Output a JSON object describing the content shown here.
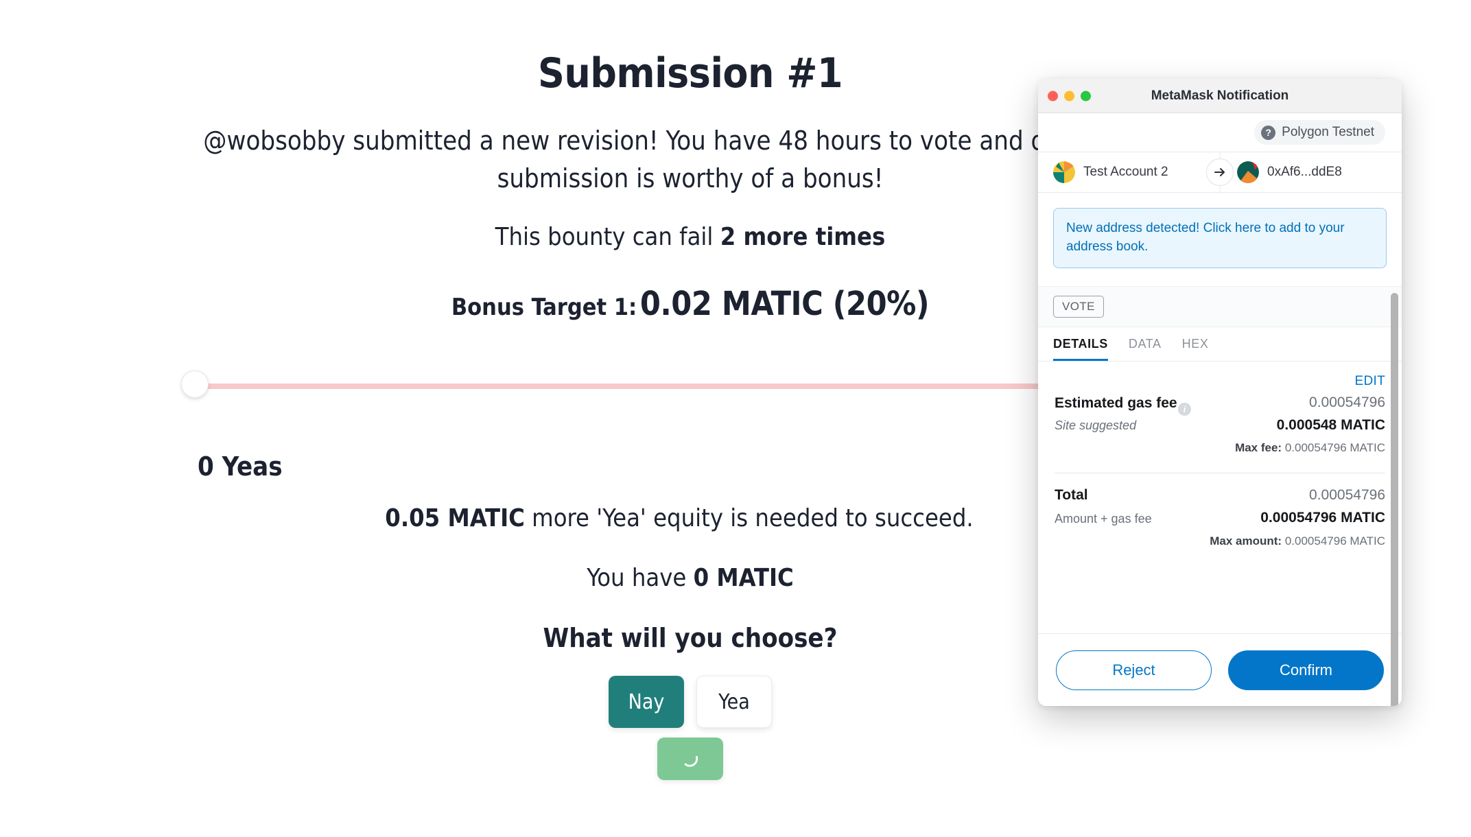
{
  "page": {
    "title": "Submission #1",
    "lede": "@wobsobby submitted a new revision! You have 48 hours to vote and decide if the submission is worthy of a bonus!",
    "fail_prefix": "This bounty can fail ",
    "fail_count": "2 more times",
    "bonus_label": "Bonus Target 1:",
    "bonus_value": "0.02 MATIC (20%)",
    "yeas_count": "0 Yeas",
    "equity_amount": "0.05 MATIC",
    "equity_rest": " more 'Yea' equity is needed to succeed.",
    "balance_prefix": "You have ",
    "balance_amount": "0 MATIC",
    "choose_prompt": "What will you choose?",
    "vote_nay": "Nay",
    "vote_yea": "Yea",
    "submit_icon": "spinner-icon",
    "slider": {
      "value_percent": 0
    }
  },
  "metamask": {
    "window_title": "MetaMask Notification",
    "traffic_lights": [
      "close-button",
      "minimize-button",
      "zoom-button"
    ],
    "network": {
      "name": "Polygon Testnet",
      "icon": "question-mark-icon"
    },
    "accounts": {
      "from": "Test Account 2",
      "to": "0xAf6...ddE8",
      "arrow_icon": "arrow-right-icon"
    },
    "address_notice": "New address detected! Click here to add to your address book.",
    "method_badge": "VOTE",
    "tabs": [
      {
        "label": "DETAILS",
        "active": true
      },
      {
        "label": "DATA",
        "active": false
      },
      {
        "label": "HEX",
        "active": false
      }
    ],
    "edit_label": "EDIT",
    "gas": {
      "title": "Estimated gas fee",
      "subtitle": "Site suggested",
      "info_icon": "info-icon",
      "native": "0.00054796",
      "fiat": "0.000548 MATIC",
      "max_label": "Max fee:",
      "max_value": "0.00054796 MATIC"
    },
    "total": {
      "title": "Total",
      "subtitle": "Amount + gas fee",
      "native": "0.00054796",
      "fiat": "0.00054796 MATIC",
      "max_label": "Max amount:",
      "max_value": "0.00054796 MATIC"
    },
    "buttons": {
      "reject": "Reject",
      "confirm": "Confirm"
    },
    "colors": {
      "accent_blue": "#0376c9",
      "notice_bg": "#eaf6fd",
      "notice_border": "#97c9ed"
    }
  }
}
